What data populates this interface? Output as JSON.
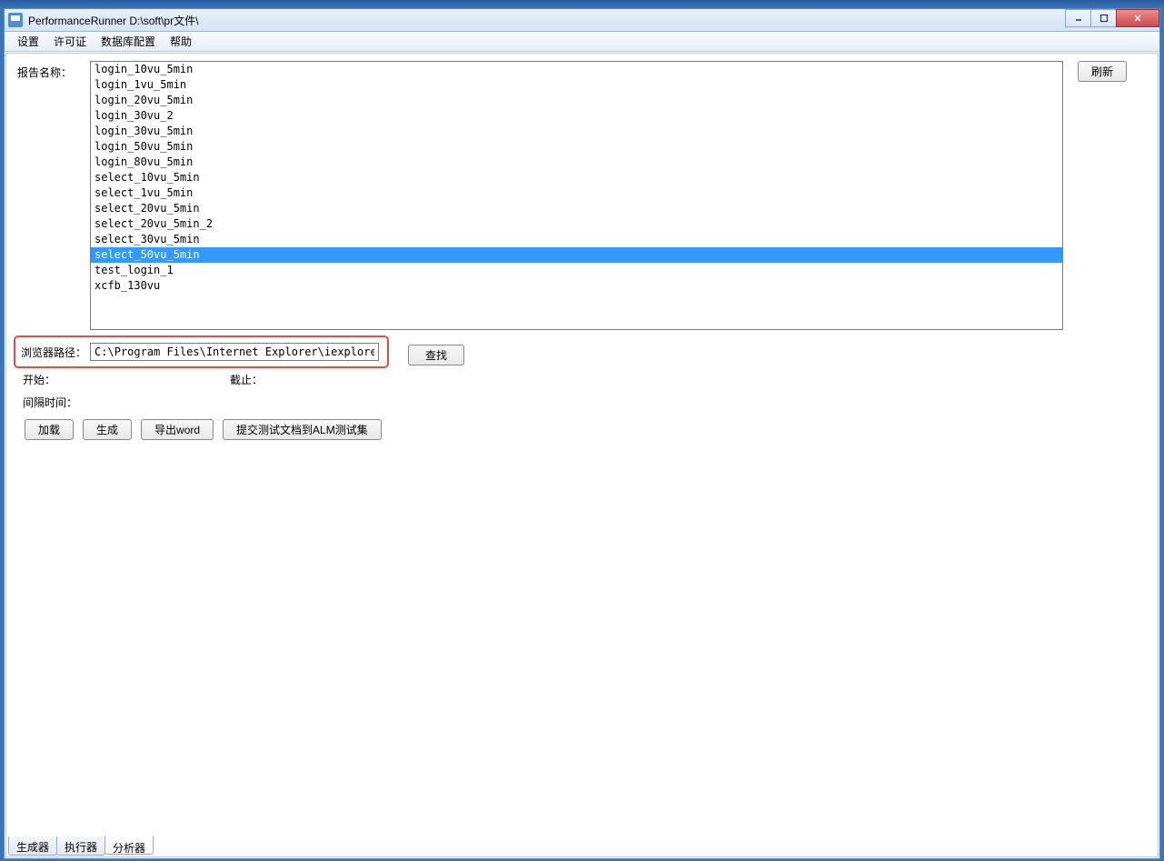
{
  "window": {
    "title": "PerformanceRunner  D:\\soft\\pr文件\\"
  },
  "menubar": {
    "items": [
      "设置",
      "许可证",
      "数据库配置",
      "帮助"
    ]
  },
  "labels": {
    "report_name": "报告名称：",
    "browser_path": "浏览器路径：",
    "start": "开始：",
    "end": "截止：",
    "interval": "间隔时间："
  },
  "report_list": {
    "items": [
      "login_10vu_5min",
      "login_1vu_5min",
      "login_20vu_5min",
      "login_30vu_2",
      "login_30vu_5min",
      "login_50vu_5min",
      "login_80vu_5min",
      "select_10vu_5min",
      "select_1vu_5min",
      "select_20vu_5min",
      "select_20vu_5min_2",
      "select_30vu_5min",
      "select_50vu_5min",
      "test_login_1",
      "xcfb_130vu"
    ],
    "selected_index": 12
  },
  "browser": {
    "path": "C:\\Program Files\\Internet Explorer\\iexplore.exe"
  },
  "buttons": {
    "refresh": "刷新",
    "find": "查找",
    "load": "加载",
    "generate": "生成",
    "export_word": "导出word",
    "submit_alm": "提交测试文档到ALM测试集"
  },
  "bottom_tabs": {
    "items": [
      "生成器",
      "执行器",
      "分析器"
    ],
    "active_index": 2
  }
}
